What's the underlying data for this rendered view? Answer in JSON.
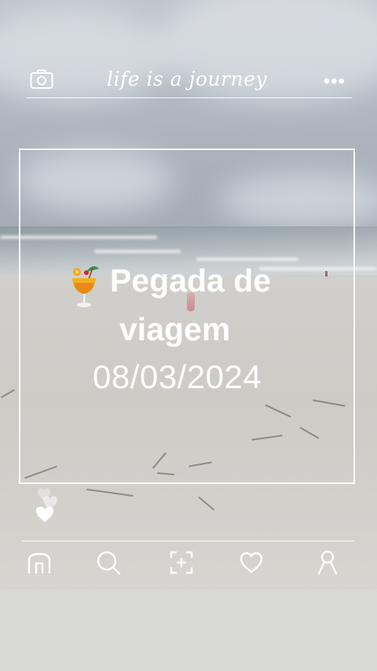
{
  "header": {
    "title": "life is a journey",
    "camera_icon": "camera-icon",
    "menu_icon": "more-dots-icon",
    "menu_glyph": "•••"
  },
  "post": {
    "emoji_icon": "tropical-drink-icon",
    "headline_line1": "Pegada de",
    "headline_line2": "viagem",
    "date": "08/03/2024"
  },
  "reactions": {
    "icon": "heart-icon"
  },
  "navbar": {
    "items": [
      {
        "name": "home",
        "icon": "home-icon"
      },
      {
        "name": "search",
        "icon": "search-icon"
      },
      {
        "name": "add",
        "icon": "add-frame-icon"
      },
      {
        "name": "likes",
        "icon": "heart-outline-icon"
      },
      {
        "name": "profile",
        "icon": "profile-icon"
      }
    ]
  },
  "colors": {
    "overlay": "#ffffff",
    "sky": "#b3bac3",
    "sand": "#cfcdc8"
  }
}
